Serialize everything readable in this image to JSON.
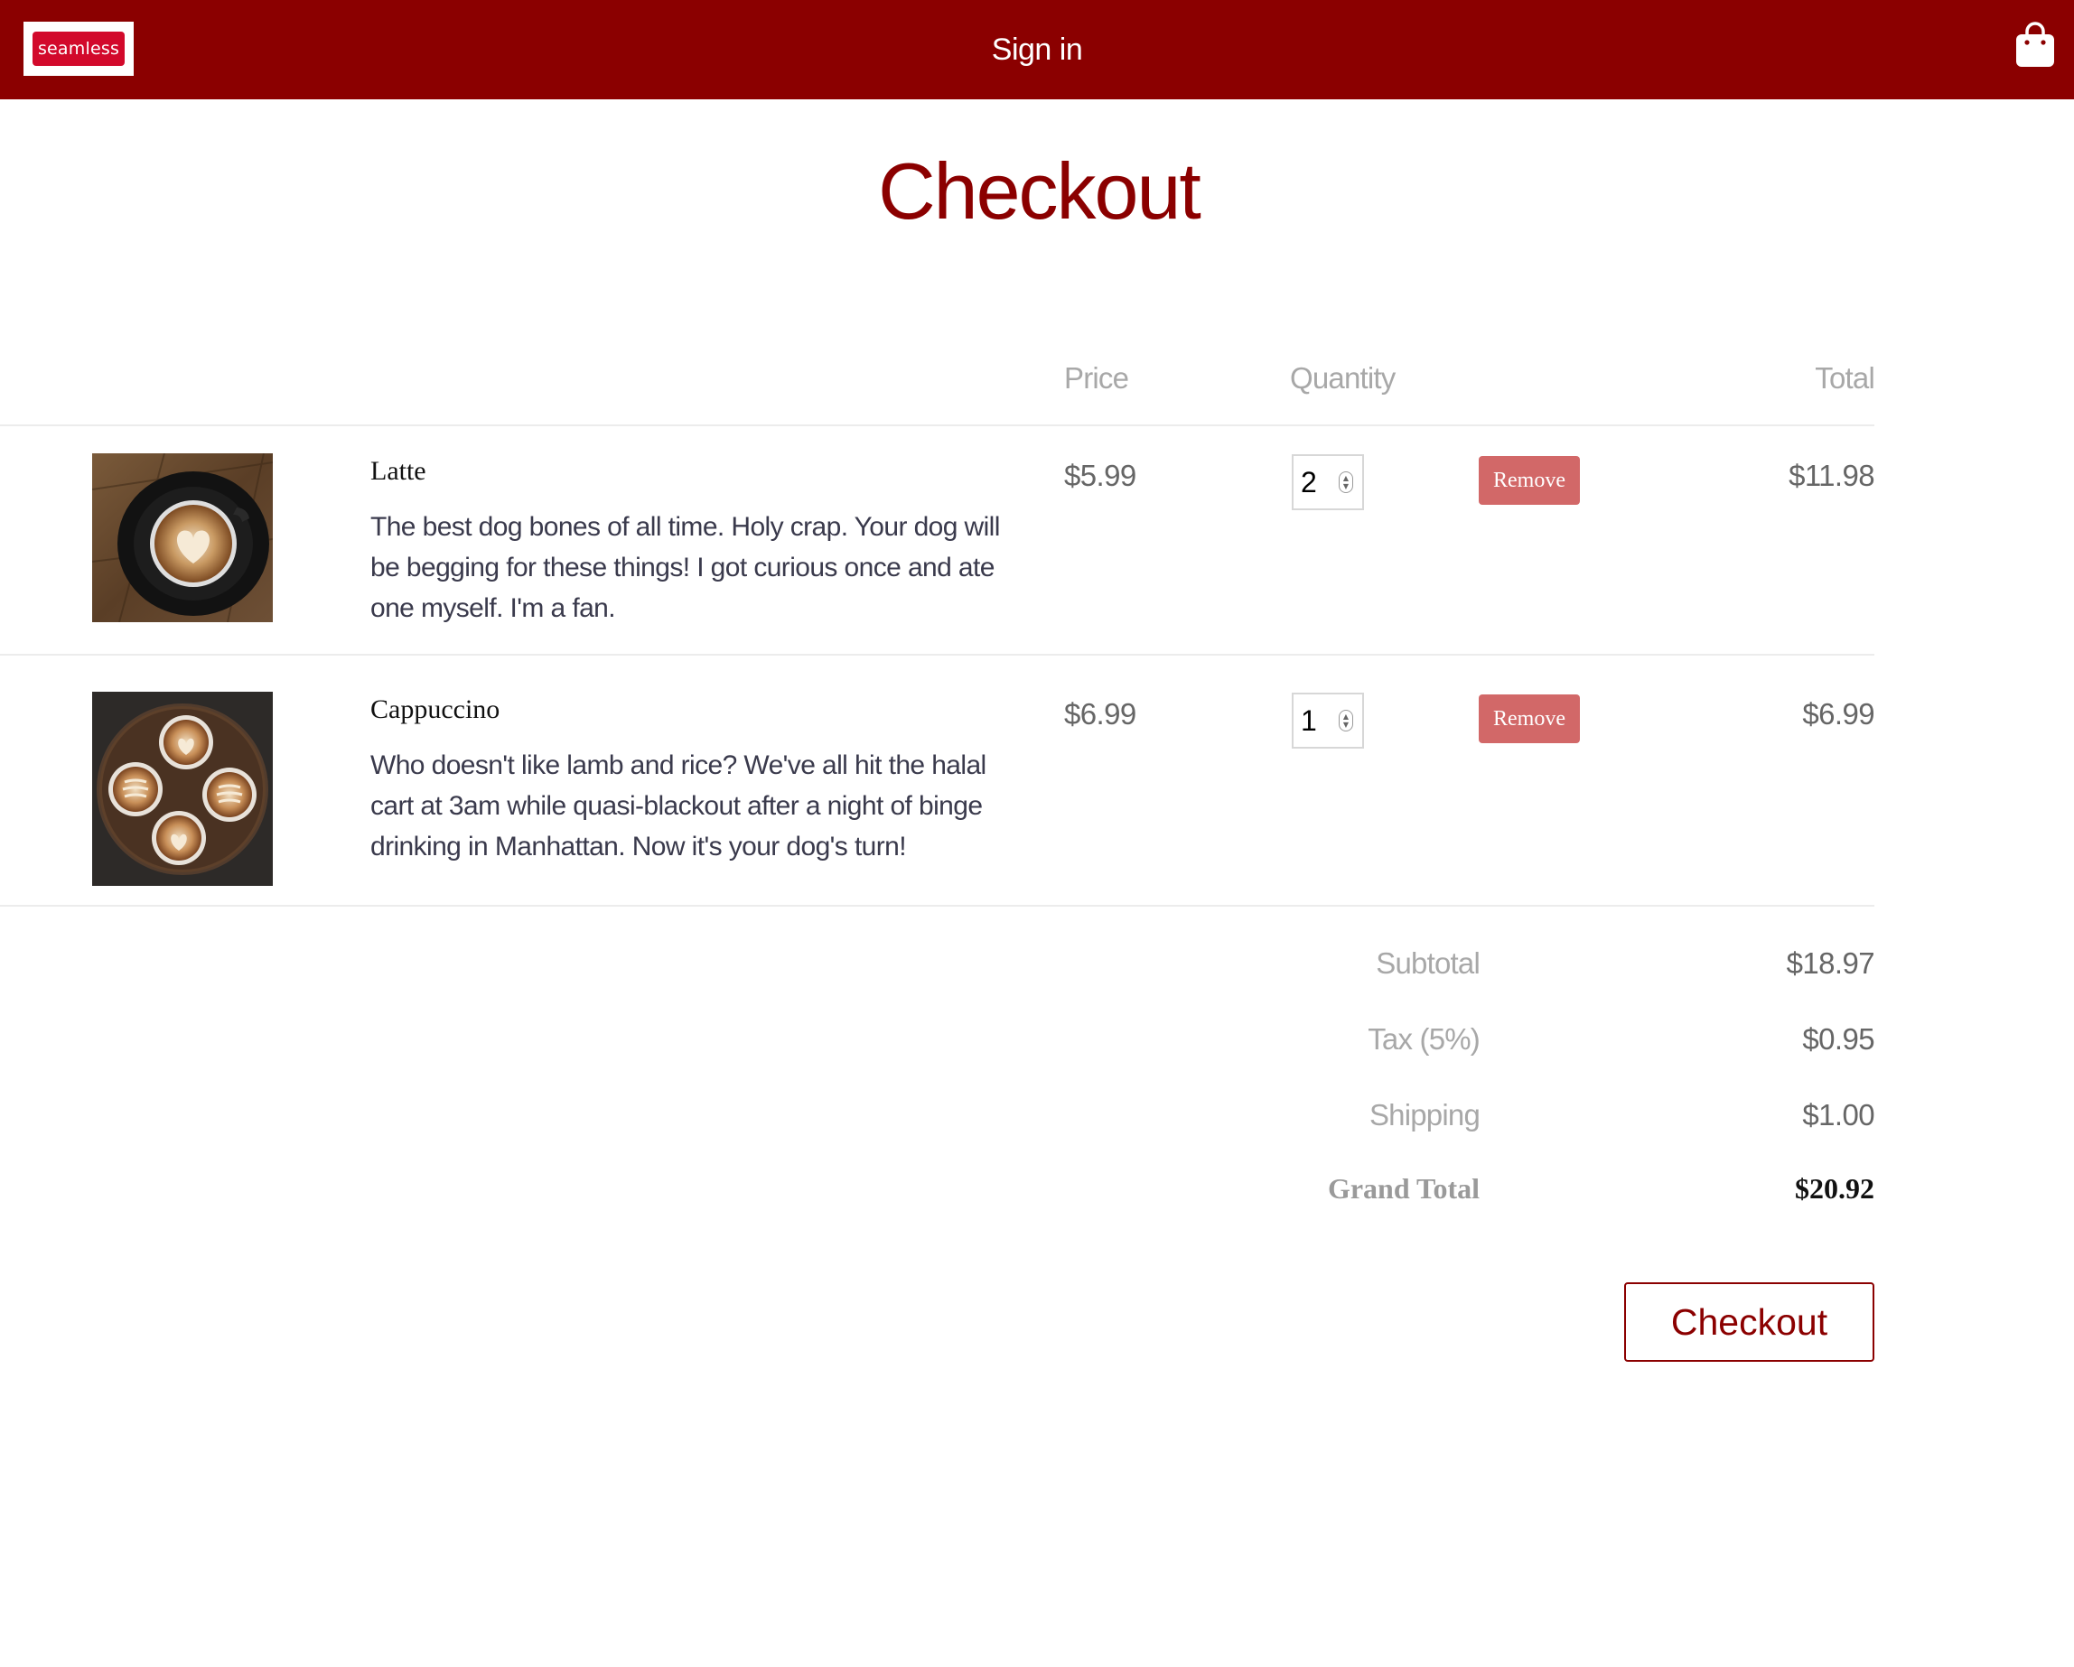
{
  "header": {
    "logo_text": "seamless",
    "signin_label": "Sign in",
    "cart_icon": "shopping-bag-icon"
  },
  "page": {
    "title": "Checkout"
  },
  "columns": {
    "price": "Price",
    "quantity": "Quantity",
    "total": "Total"
  },
  "items": [
    {
      "name": "Latte",
      "description": "The best dog bones of all time. Holy crap. Your dog will be begging for these things! I got curious once and ate one myself. I'm a fan.",
      "price": "$5.99",
      "quantity": "2",
      "remove_label": "Remove",
      "total": "$11.98",
      "image": "latte-art-heart-photo"
    },
    {
      "name": "Cappuccino",
      "description": "Who doesn't like lamb and rice? We've all hit the halal cart at 3am while quasi-blackout after a night of binge drinking in Manhattan. Now it's your dog's turn!",
      "price": "$6.99",
      "quantity": "1",
      "remove_label": "Remove",
      "total": "$6.99",
      "image": "four-cappuccinos-photo"
    }
  ],
  "summary": {
    "subtotal_label": "Subtotal",
    "subtotal": "$18.97",
    "tax_label": "Tax (5%)",
    "tax": "$0.95",
    "shipping_label": "Shipping",
    "shipping": "$1.00",
    "grand_total_label": "Grand Total",
    "grand_total": "$20.92"
  },
  "checkout_button": "Checkout",
  "colors": {
    "brand": "#8b0000",
    "logo_red": "#d2092b",
    "remove_button": "#d26868"
  }
}
